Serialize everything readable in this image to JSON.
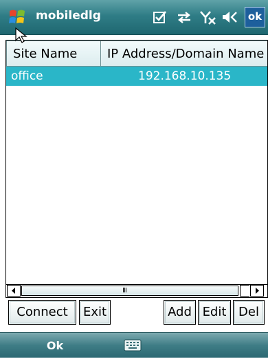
{
  "titlebar": {
    "title": "mobiledlg",
    "ok_label": "ok",
    "icons": [
      "start-logo-icon",
      "checkbox-icon",
      "sync-arrows-icon",
      "no-signal-icon",
      "speaker-muted-icon"
    ]
  },
  "listview": {
    "columns": [
      "Site Name",
      "IP Address/Domain Name"
    ],
    "rows": [
      {
        "site": "office",
        "address": "192.168.10.135",
        "selected": true
      }
    ],
    "scrollbar_grip": "III"
  },
  "buttons": {
    "connect": "Connect",
    "exit": "Exit",
    "add": "Add",
    "edit": "Edit",
    "del": "Del"
  },
  "softkeys": {
    "left": "Ok",
    "center_icon": "keyboard-icon"
  },
  "colors": {
    "titlebar": "#2f7d86",
    "selection": "#2ab6c8",
    "ok_button": "#1d5f9c"
  }
}
